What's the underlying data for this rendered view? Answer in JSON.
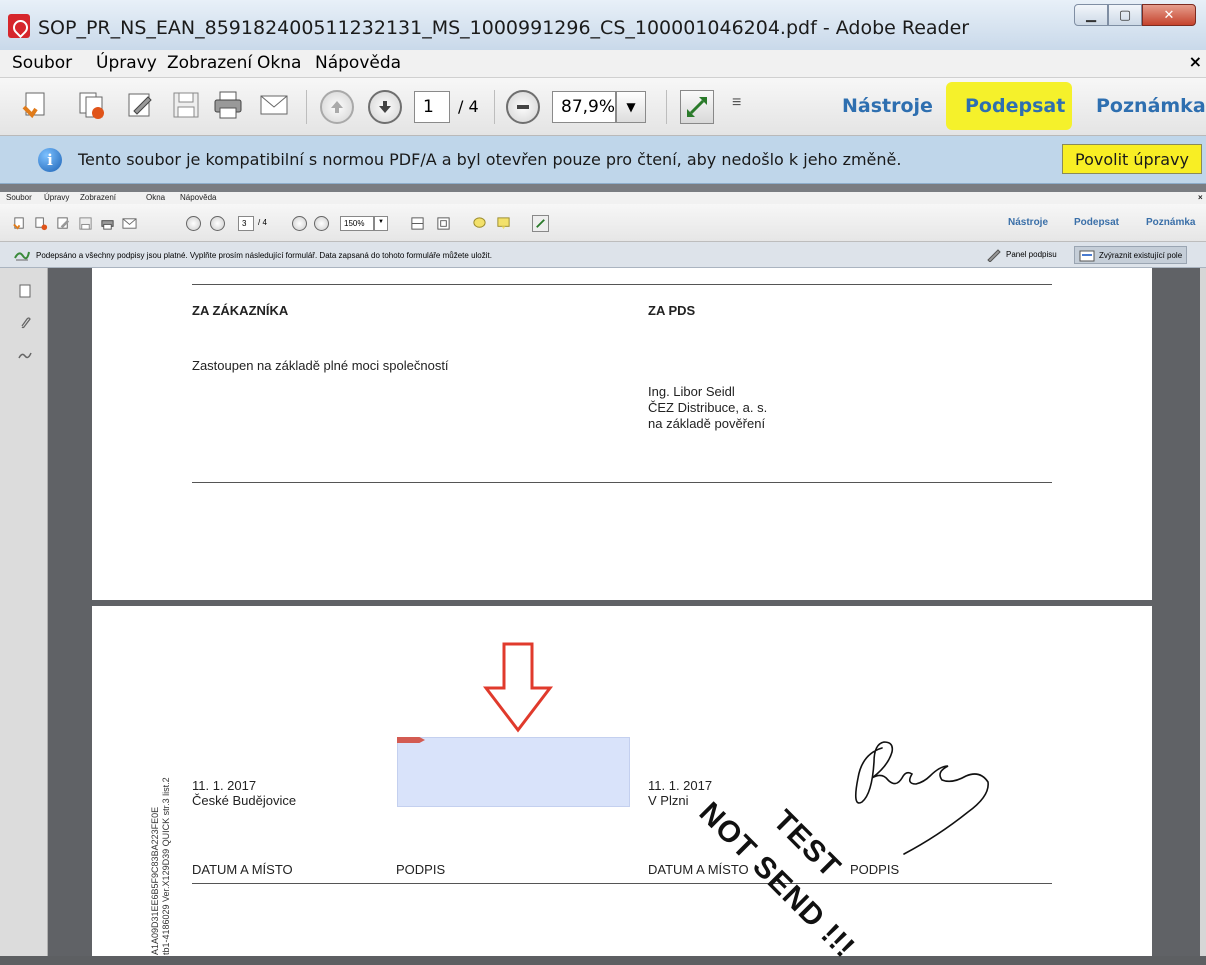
{
  "outer_window": {
    "title": "SOP_PR_NS_EAN_859182400511232131_MS_1000991296_CS_100001046204.pdf - Adobe Reader",
    "menu": [
      "Soubor",
      "Úpravy",
      "Zobrazení",
      "Okna",
      "Nápověda"
    ],
    "menu_close": "×",
    "toolbar": {
      "page_current": "1",
      "page_total": "/ 4",
      "zoom": "87,9%",
      "tools_label": "Nástroje",
      "sign_label": "Podepsat",
      "comment_label": "Poznámka"
    },
    "info_bar": {
      "message": "Tento soubor je kompatibilní s normou PDF/A a byl otevřen pouze pro čtení, aby nedošlo k jeho změně.",
      "enable_edit_button": "Povolit úpravy"
    },
    "highlight_color": "#f5f12b"
  },
  "inner_window": {
    "menu": [
      "Soubor",
      "Úpravy",
      "Zobrazení",
      "Okna",
      "Nápověda"
    ],
    "menu_close": "×",
    "toolbar": {
      "page_current": "3",
      "page_total": "/ 4",
      "zoom": "150%",
      "tools_label": "Nástroje",
      "sign_label": "Podepsat",
      "comment_label": "Poznámka"
    },
    "info_bar": {
      "message": "Podepsáno a všechny podpisy jsou platné.  Vyplňte prosím následující formulář. Data zapsaná do tohoto formuláře můžete uložit.",
      "signature_panel_button": "Panel podpisu",
      "highlight_fields_button": "Zvýraznit existující pole"
    }
  },
  "document": {
    "page_upper": {
      "customer_heading": "ZA ZÁKAZNÍKA",
      "pds_heading": "ZA PDS",
      "customer_note": "Zastoupen na základě plné moci společností",
      "pds_signer_name": "Ing. Libor Seidl",
      "pds_signer_company": "ČEZ Distribuce, a. s.",
      "pds_signer_basis": "na základě pověření"
    },
    "page_lower": {
      "left_date": "11. 1. 2017",
      "left_place": "České Budějovice",
      "right_date": "11. 1. 2017",
      "right_place": "V Plzni",
      "left_date_place_label": "DATUM A MÍSTO",
      "left_signature_label": "PODPIS",
      "right_date_place_label": "DATUM A MÍSTO",
      "right_signature_label": "PODPIS",
      "side_code_line1": "A1A09D31EE6B5F9C83BA223FE0E",
      "side_code_line2": "tb1-4186029 Ver.X129D39 QUICK str.3 list.2",
      "stamp_line1": "TEST",
      "stamp_line2": "NOT SEND !!!"
    },
    "signature_field_color": "#d9e3fa",
    "arrow_color": "#e03a2c"
  }
}
